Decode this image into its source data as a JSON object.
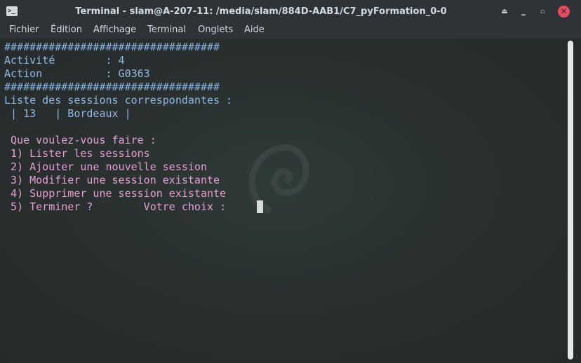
{
  "window": {
    "title": "Terminal - slam@A-207-11: /media/slam/884D-AAB1/C7_pyFormation_0-0",
    "app_icon_glyph": ">_",
    "controls": {
      "shade": "⏏",
      "minimize": "‗",
      "maximize": "▫",
      "close": "✕"
    }
  },
  "menubar": {
    "items": [
      "Fichier",
      "Édition",
      "Affichage",
      "Terminal",
      "Onglets",
      "Aide"
    ]
  },
  "terminal": {
    "lines": [
      {
        "text": "##################################",
        "color": "#8fb8e6"
      },
      {
        "text": "Activité        : 4",
        "color": "#8fb8e6"
      },
      {
        "text": "Action          : G0363",
        "color": "#8fb8e6"
      },
      {
        "text": "##################################",
        "color": "#8fb8e6"
      },
      {
        "text": "Liste des sessions correspondantes :",
        "color": "#8fb8e6"
      },
      {
        "text": " | 13   | Bordeaux |",
        "color": "#8fb8e6"
      },
      {
        "text": "",
        "color": "#e69fd3"
      },
      {
        "text": " Que voulez-vous faire :",
        "color": "#e69fd3"
      },
      {
        "text": " 1) Lister les sessions",
        "color": "#e69fd3"
      },
      {
        "text": " 2) Ajouter une nouvelle session",
        "color": "#e69fd3"
      },
      {
        "text": " 3) Modifier une session existante",
        "color": "#e69fd3"
      },
      {
        "text": " 4) Supprimer une session existante",
        "color": "#e69fd3"
      },
      {
        "text": " 5) Terminer ?        Votre choix : ",
        "color": "#e69fd3"
      }
    ],
    "colors": {
      "info_text": "#8fb8e6",
      "menu_text": "#e69fd3",
      "background": "#29302f",
      "cursor": "#d8dadc"
    }
  },
  "scrollbar": {
    "position_fraction": 0
  }
}
